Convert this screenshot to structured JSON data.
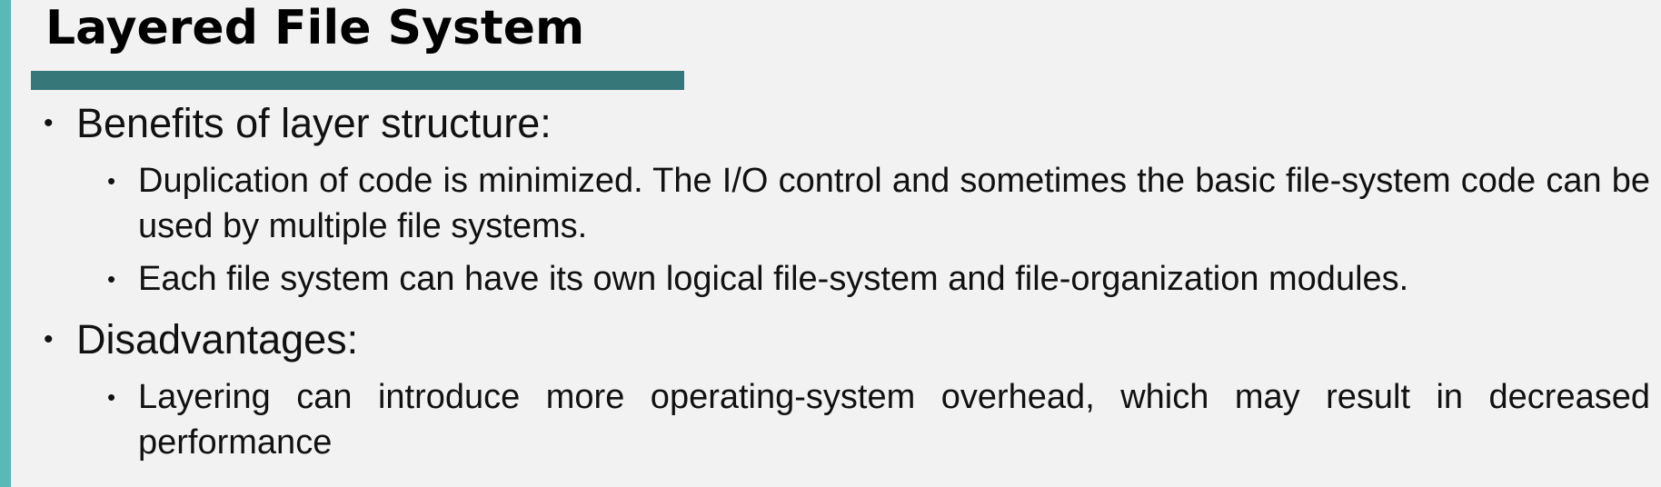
{
  "slide": {
    "title": "Layered File System",
    "bullet_glyph": "•",
    "sections": [
      {
        "heading": "Benefits of layer structure:",
        "points": [
          "Duplication of code is minimized. The I/O control and sometimes the basic file-system code can be used by multiple file systems.",
          "Each file system can have its own logical file-system and file-organization modules."
        ]
      },
      {
        "heading": "Disadvantages:",
        "points": [
          "Layering can introduce more operating-system overhead, which may result in decreased performance"
        ]
      }
    ],
    "colors": {
      "background": "#f2f2f2",
      "left_accent": "#5ab8b9",
      "title_rule": "#36777a",
      "text": "#111111"
    }
  }
}
